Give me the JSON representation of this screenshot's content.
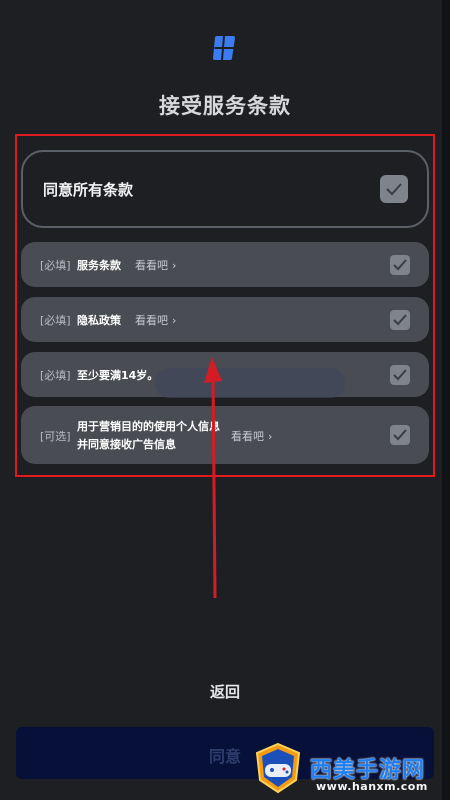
{
  "header": {
    "title": "接受服务条款"
  },
  "agree_all": {
    "label": "同意所有条款"
  },
  "terms": [
    {
      "tag": "[必填]",
      "name": "服务条款",
      "more": "看看吧"
    },
    {
      "tag": "[必填]",
      "name": "隐私政策",
      "more": "看看吧"
    },
    {
      "tag": "[必填]",
      "name": "至少要满14岁。"
    },
    {
      "tag": "[可选]",
      "name_line1": "用于营销目的的使用个人信息",
      "name_line2": "并同意接收广告信息",
      "more": "看看吧"
    }
  ],
  "footer": {
    "back_label": "返回",
    "agree_label": "同意"
  },
  "watermark": {
    "name": "西美手游网",
    "url": "www.hanxm.com"
  },
  "colors": {
    "highlight_box": "#e0191f",
    "arrow": "#d41c24",
    "card": "#4a4c53",
    "checkbox": "#7e838c",
    "primary_button": "#061039"
  },
  "icons": {
    "logo": "app-logo-icon",
    "check": "check-icon",
    "chevron": "chevron-right-icon"
  }
}
